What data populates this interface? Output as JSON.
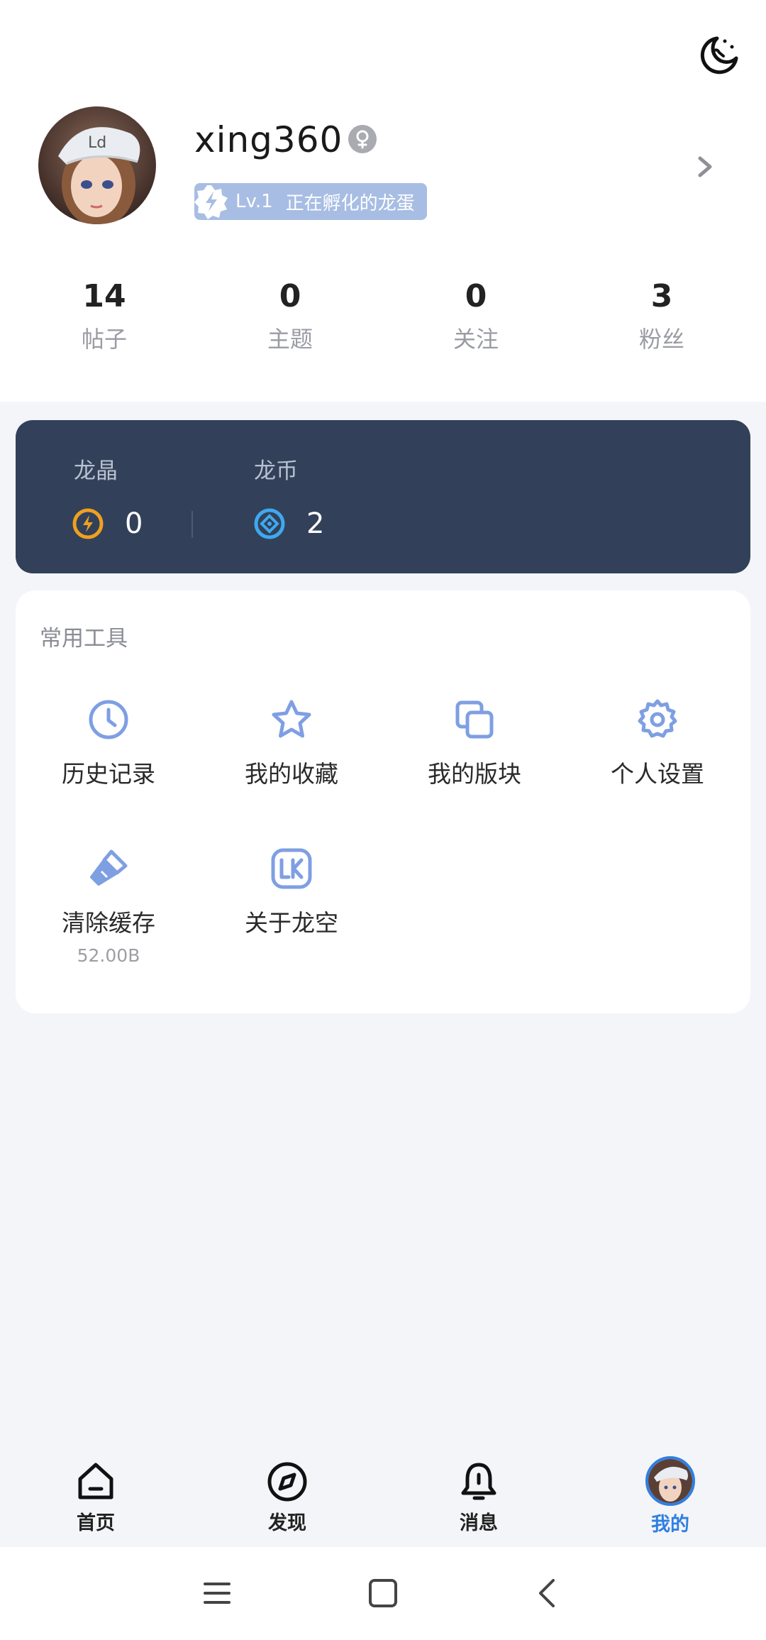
{
  "profile": {
    "username": "xing360",
    "level": "Lv.1",
    "level_title": "正在孵化的龙蛋"
  },
  "stats": [
    {
      "value": "14",
      "label": "帖子"
    },
    {
      "value": "0",
      "label": "主题"
    },
    {
      "value": "0",
      "label": "关注"
    },
    {
      "value": "3",
      "label": "粉丝"
    }
  ],
  "wallet": {
    "crystal_label": "龙晶",
    "crystal_value": "0",
    "coin_label": "龙币",
    "coin_value": "2"
  },
  "tools": {
    "title": "常用工具",
    "items": [
      {
        "label": "历史记录",
        "icon": "clock-icon"
      },
      {
        "label": "我的收藏",
        "icon": "star-icon"
      },
      {
        "label": "我的版块",
        "icon": "copy-icon"
      },
      {
        "label": "个人设置",
        "icon": "gear-icon"
      },
      {
        "label": "清除缓存",
        "icon": "brush-icon",
        "sub": "52.00B"
      },
      {
        "label": "关于龙空",
        "icon": "lk-logo-icon"
      }
    ]
  },
  "nav": [
    {
      "label": "首页",
      "icon": "home-icon"
    },
    {
      "label": "发现",
      "icon": "compass-icon"
    },
    {
      "label": "消息",
      "icon": "bell-icon"
    },
    {
      "label": "我的",
      "icon": "avatar-icon"
    }
  ],
  "colors": {
    "accent": "#2f7fe0",
    "wallet_bg": "#324159",
    "tool_icon": "#7f9fe3",
    "level_badge": "#a8bde3",
    "crystal": "#f0a020",
    "coin": "#3fa8f0"
  }
}
